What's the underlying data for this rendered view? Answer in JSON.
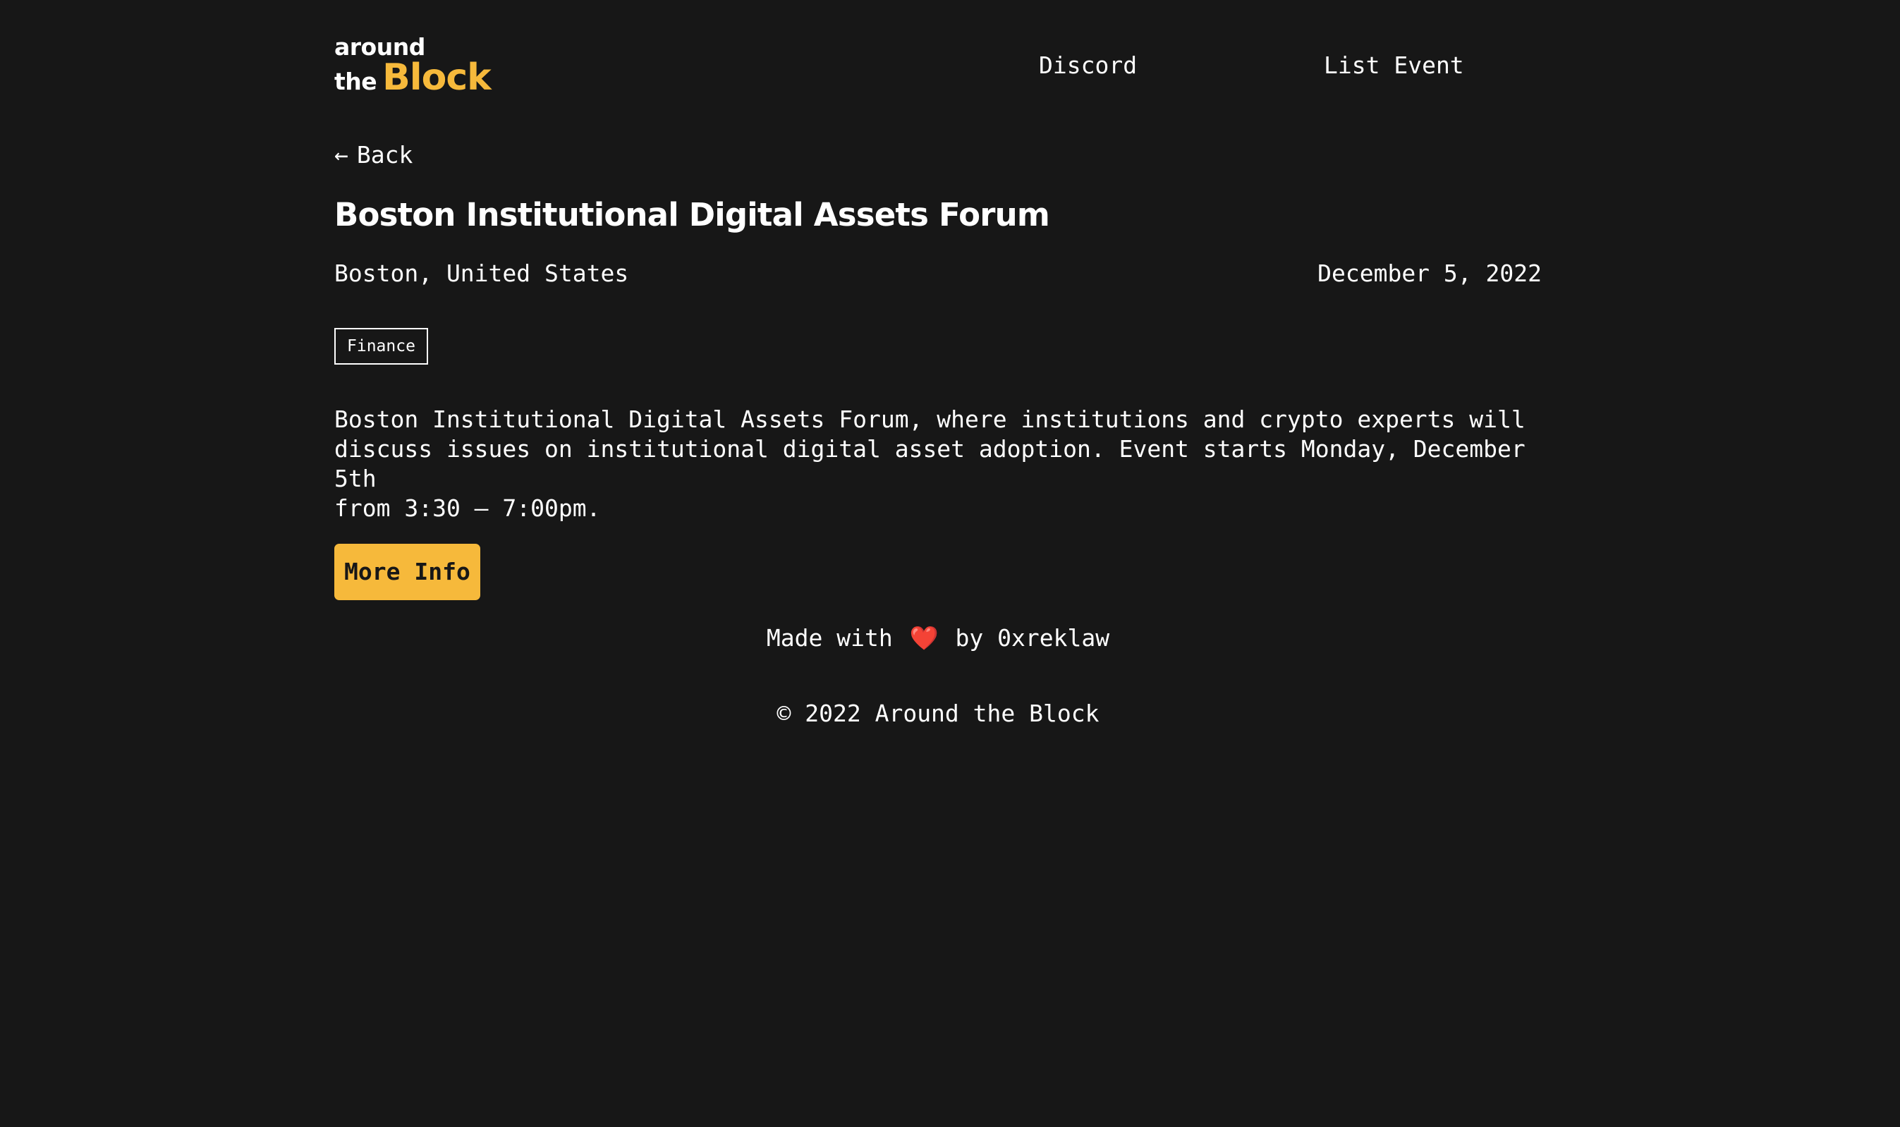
{
  "header": {
    "logo": {
      "line1": "around",
      "line2_prefix": "the",
      "line2_accent": "Block",
      "accent_color": "#f6b93b"
    },
    "nav": [
      {
        "label": "Discord"
      },
      {
        "label": "List Event"
      }
    ]
  },
  "back": {
    "icon": "left-arrow-icon",
    "arrow": "←",
    "label": "Back"
  },
  "event": {
    "title": "Boston Institutional Digital Assets Forum",
    "location": "Boston, United States",
    "date": "December 5, 2022",
    "tag": "Finance",
    "description": "Boston Institutional Digital Assets Forum, where institutions and crypto experts will\ndiscuss issues on institutional digital asset adoption. Event starts Monday, December 5th\nfrom 3:30 – 7:00pm.",
    "more_info_label": "More Info"
  },
  "footer": {
    "made_prefix": "Made with",
    "heart_icon": "heart-icon",
    "heart": "❤️",
    "made_suffix": "by 0xreklaw",
    "copyright": "© 2022 Around the Block"
  },
  "colors": {
    "background": "#171717",
    "text": "#ffffff",
    "accent": "#f6b93b"
  }
}
